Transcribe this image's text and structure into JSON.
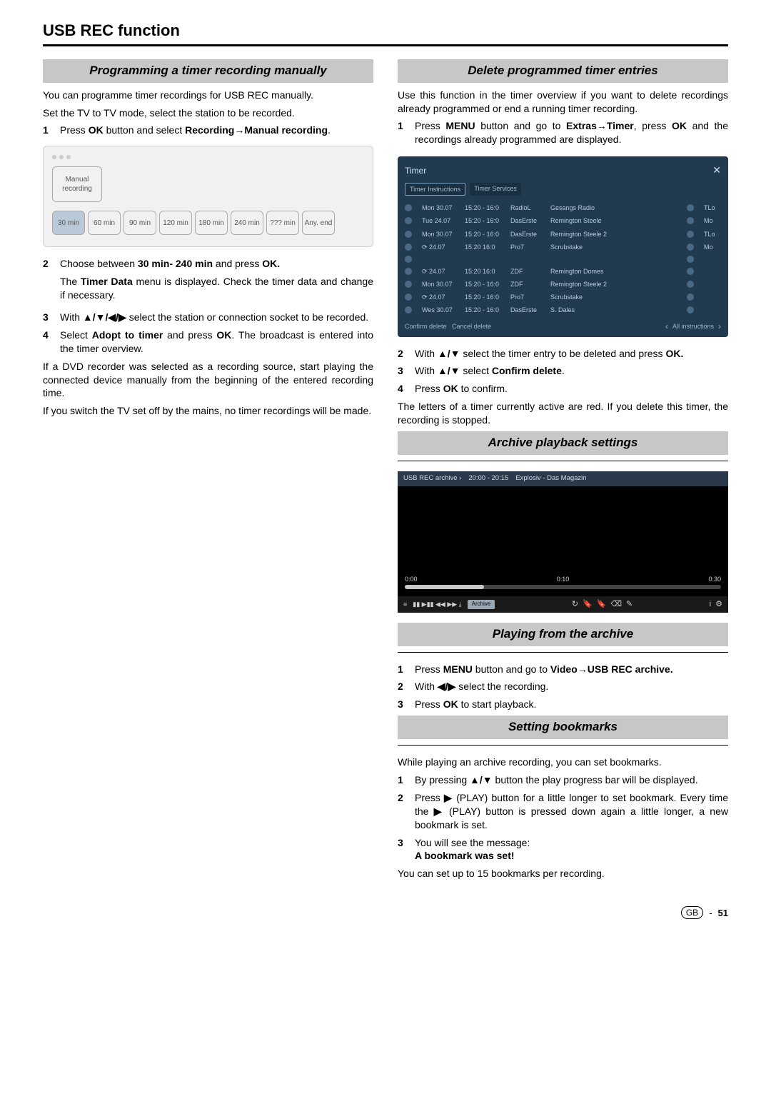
{
  "pageTitle": "USB REC function",
  "left": {
    "sec1": {
      "title": "Programming a timer recording manually",
      "p1": "You can programme timer recordings for USB REC manually.",
      "p2": "Set the TV to TV mode, select the station to be recorded.",
      "s1_a": "Press ",
      "s1_b": "OK",
      "s1_c": " button and select ",
      "s1_d": "Recording",
      "s1_arrow": "→",
      "s1_e": "Manual recording",
      "s1_f": ".",
      "fig": {
        "tile_main": "Manual recording",
        "t1": "30 min",
        "t2": "60 min",
        "t3": "90 min",
        "t4": "120 min",
        "t5": "180 min",
        "t6": "240 min",
        "t7": "??? min",
        "t8": "Any. end"
      },
      "s2_a": "Choose between ",
      "s2_b": "30 min- 240 min",
      "s2_c": "  and press ",
      "s2_d": "OK.",
      "s2_p2a": "The ",
      "s2_p2b": "Timer Data",
      "s2_p2c": " menu is displayed. Check the timer data and change if necessary.",
      "s3_a": "With ",
      "s3_b": "▲/▼/◀/▶",
      "s3_c": " select the station or connection socket to be recorded.",
      "s4_a": "Select ",
      "s4_b": "Adopt to timer",
      "s4_c": " and press ",
      "s4_d": "OK",
      "s4_e": ". The broadcast is entered into the timer overview.",
      "p3": "If a DVD recorder was selected as a recording source, start playing the connected device manually from the beginning of the entered recording time.",
      "p4": "If you switch the TV set off by the mains, no timer recordings will be made."
    }
  },
  "right": {
    "sec2": {
      "title": "Delete programmed timer entries",
      "p1": "Use this function in the timer overview if you want to delete recordings already programmed or end a running timer recording.",
      "s1_a": "Press ",
      "s1_b": "MENU",
      "s1_c": " button and go to ",
      "s1_d": "Extras",
      "s1_arrow": "→",
      "s1_e": "Timer",
      "s1_f": ", press ",
      "s1_g": "OK",
      "s1_h": " and the recordings already programmed are displayed.",
      "scr": {
        "title": "Timer",
        "tab1": "Timer Instructions",
        "tab2": "Timer Services",
        "rows": [
          {
            "c1": "Mon 30.07",
            "c2": "15:20 - 16:0",
            "c3": "RadioL",
            "c4": "Gesangs Radio",
            "c5": "TLo"
          },
          {
            "c1": "Tue  24.07",
            "c2": "15:20 - 16:0",
            "c3": "DasErste",
            "c4": "Remington Steele",
            "c5": "Mo"
          },
          {
            "c1": "Mon 30.07",
            "c2": "15:20 - 16:0",
            "c3": "DasErste",
            "c4": "Remington Steele 2",
            "c5": "TLo"
          },
          {
            "c1": "⟳   24.07",
            "c2": "15:20  16:0",
            "c3": "Pro7",
            "c4": "Scrubstake",
            "c5": "Mo"
          },
          {
            "c1": "",
            "c2": "",
            "c3": "",
            "c4": "",
            "c5": ""
          },
          {
            "c1": "⟳   24.07",
            "c2": "15:20  16:0",
            "c3": "ZDF",
            "c4": "Remington Domes",
            "c5": ""
          },
          {
            "c1": "Mon 30.07",
            "c2": "15:20 - 16:0",
            "c3": "ZDF",
            "c4": "Remington Steele 2",
            "c5": ""
          },
          {
            "c1": "⟳   24.07",
            "c2": "15:20 - 16:0",
            "c3": "Pro7",
            "c4": "Scrubstake",
            "c5": ""
          },
          {
            "c1": "Wes 30.07",
            "c2": "15:20 - 16:0",
            "c3": "DasErste",
            "c4": "S. Dales",
            "c5": ""
          }
        ],
        "foot_confirm": "Confirm delete",
        "foot_cancel": "Cancel delete",
        "foot_instr": "All instructions"
      },
      "s2_a": "With ",
      "s2_b": "▲/▼",
      "s2_c": " select the timer entry to be deleted and press ",
      "s2_d": "OK.",
      "s3_a": "With ",
      "s3_b": "▲/▼",
      "s3_c": " select ",
      "s3_d": "Confirm delete",
      "s3_e": ".",
      "s4_a": "Press ",
      "s4_b": "OK",
      "s4_c": " to confirm.",
      "p2": "The letters of a timer currently active are red. If you delete this timer, the recording is stopped."
    },
    "sec3": {
      "title": "Archive playback settings",
      "arc": {
        "src": "USB REC archive ›",
        "time": "20:00 - 20:15",
        "prog": "Explosiv - Das Magazin",
        "t0": "0:00",
        "t1": "0:10",
        "t2": "0:30",
        "chip": "Archive",
        "ctrls": "▮▮  ▶▮▮  ◀◀  ▶▶  ⤓"
      }
    },
    "sec4": {
      "title": "Playing from the archive",
      "s1_a": "Press ",
      "s1_b": "MENU",
      "s1_c": " button and go to ",
      "s1_d": "Video",
      "s1_arrow": "→",
      "s1_e": "USB REC archive.",
      "s2_a": "With ",
      "s2_b": "◀/▶",
      "s2_c": " select the recording.",
      "s3_a": "Press ",
      "s3_b": "OK",
      "s3_c": " to start playback."
    },
    "sec5": {
      "title": "Setting bookmarks",
      "p1": "While playing an archive recording, you can set bookmarks.",
      "s1_a": "By pressing ",
      "s1_b": "▲/▼",
      "s1_c": " button the play progress bar will be displayed.",
      "s2_a": "Press ",
      "s2_b": "▶",
      "s2_c": " (PLAY) button for a little longer to set bookmark. Every time the ",
      "s2_d": "▶",
      "s2_e": " (PLAY) button is pressed down again a little longer, a new bookmark is set.",
      "s3_a": "You will see the message: ",
      "s3_b": "A bookmark was set!",
      "p2": "You can set up to 15 bookmarks per recording."
    }
  },
  "footer": {
    "region": "GB",
    "page": "51"
  }
}
